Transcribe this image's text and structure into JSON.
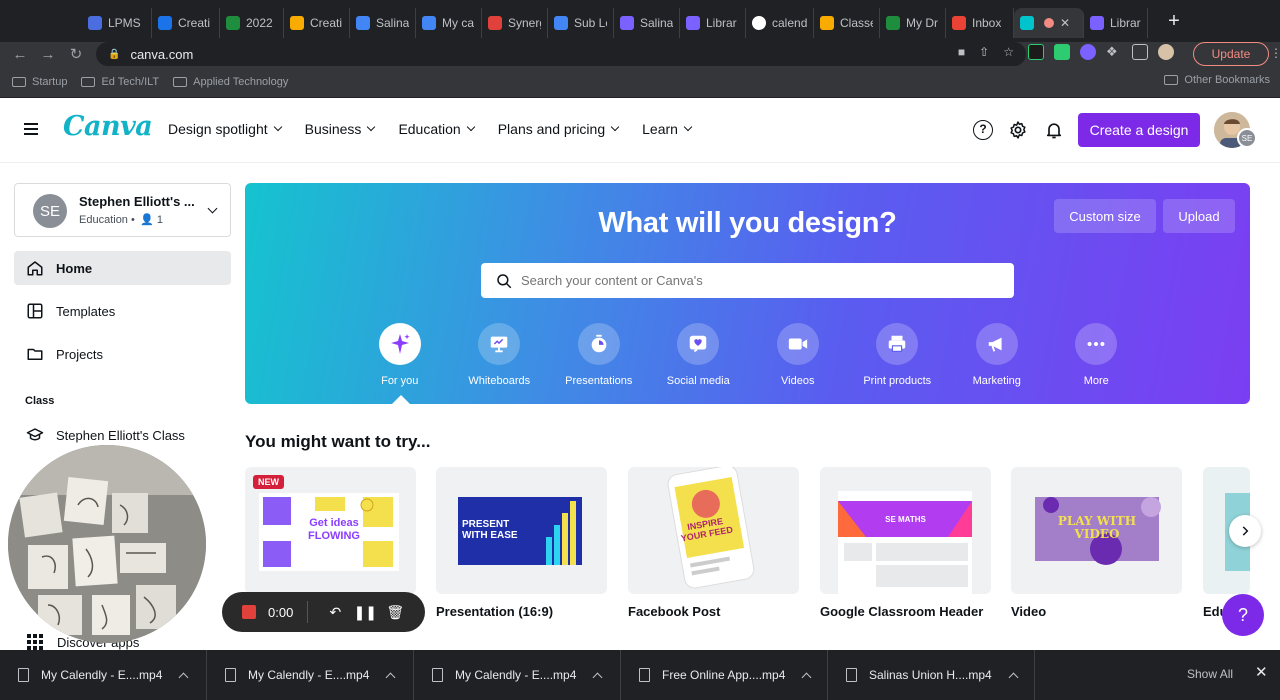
{
  "browser": {
    "tabs": [
      {
        "label": "LPMS",
        "color": "#4a6ee0"
      },
      {
        "label": "Creati",
        "color": "#1a73e8"
      },
      {
        "label": "2022",
        "color": "#1e8e3e"
      },
      {
        "label": "Creati",
        "color": "#f9ab00"
      },
      {
        "label": "Salina",
        "color": "#4285f4"
      },
      {
        "label": "My ca",
        "color": "#4285f4"
      },
      {
        "label": "Synerg",
        "color": "#e0413b"
      },
      {
        "label": "Sub Le",
        "color": "#4285f4"
      },
      {
        "label": "Salina",
        "color": "#7b61ff"
      },
      {
        "label": "Librar",
        "color": "#7b61ff"
      },
      {
        "label": "calend",
        "color": "#ffffff"
      },
      {
        "label": "Classe",
        "color": "#f9ab00"
      },
      {
        "label": "My Dr",
        "color": "#1e8e3e"
      },
      {
        "label": "Inbox",
        "color": "#ea4335"
      },
      {
        "label": "",
        "color": "#00c4cc"
      },
      {
        "label": "Librar",
        "color": "#7b61ff"
      }
    ],
    "url": "canva.com",
    "update_label": "Update",
    "bookmarks": [
      "Startup",
      "Ed Tech/ILT",
      "Applied Technology"
    ],
    "other_bookmarks": "Other Bookmarks"
  },
  "header": {
    "logo": "Canva",
    "nav": [
      "Design spotlight",
      "Business",
      "Education",
      "Plans and pricing",
      "Learn"
    ],
    "help": "?",
    "create_label": "Create a design",
    "avatar_initials": "SE"
  },
  "sidebar": {
    "team_initials": "SE",
    "team_name": "Stephen Elliott's ...",
    "team_sub": "Education •  👤 1",
    "items": [
      {
        "label": "Home"
      },
      {
        "label": "Templates"
      },
      {
        "label": "Projects"
      }
    ],
    "section": "Class",
    "class_item": "Stephen Elliott's Class",
    "discover": "Discover apps"
  },
  "hero": {
    "title": "What will you design?",
    "custom_size": "Custom size",
    "upload": "Upload",
    "search_placeholder": "Search your content or Canva's",
    "categories": [
      {
        "label": "For you",
        "icon": "sparkle-icon"
      },
      {
        "label": "Whiteboards",
        "icon": "whiteboard-icon"
      },
      {
        "label": "Presentations",
        "icon": "presentation-icon"
      },
      {
        "label": "Social media",
        "icon": "heart-icon"
      },
      {
        "label": "Videos",
        "icon": "video-icon"
      },
      {
        "label": "Print products",
        "icon": "printer-icon"
      },
      {
        "label": "Marketing",
        "icon": "megaphone-icon"
      },
      {
        "label": "More",
        "icon": "more-icon"
      }
    ]
  },
  "suggestions": {
    "title": "You might want to try...",
    "new_badge": "NEW",
    "cards": [
      {
        "label": "",
        "thumb_text": "Get ideas FLOWING"
      },
      {
        "label": "Presentation (16:9)",
        "thumb_text": "PRESENT WITH EASE"
      },
      {
        "label": "Facebook Post",
        "thumb_text": "INSPIRE YOUR FEED"
      },
      {
        "label": "Google Classroom Header",
        "thumb_text": "SE MATHS"
      },
      {
        "label": "Video",
        "thumb_text": "PLAY WITH VIDEO"
      },
      {
        "label": "Edu",
        "thumb_text": ""
      }
    ],
    "help_fab": "?"
  },
  "recorder": {
    "time": "0:00"
  },
  "downloads": {
    "items": [
      "My Calendly - E....mp4",
      "My Calendly - E....mp4",
      "My Calendly - E....mp4",
      "Free Online App....mp4",
      "Salinas Union H....mp4"
    ],
    "show_all": "Show All"
  }
}
